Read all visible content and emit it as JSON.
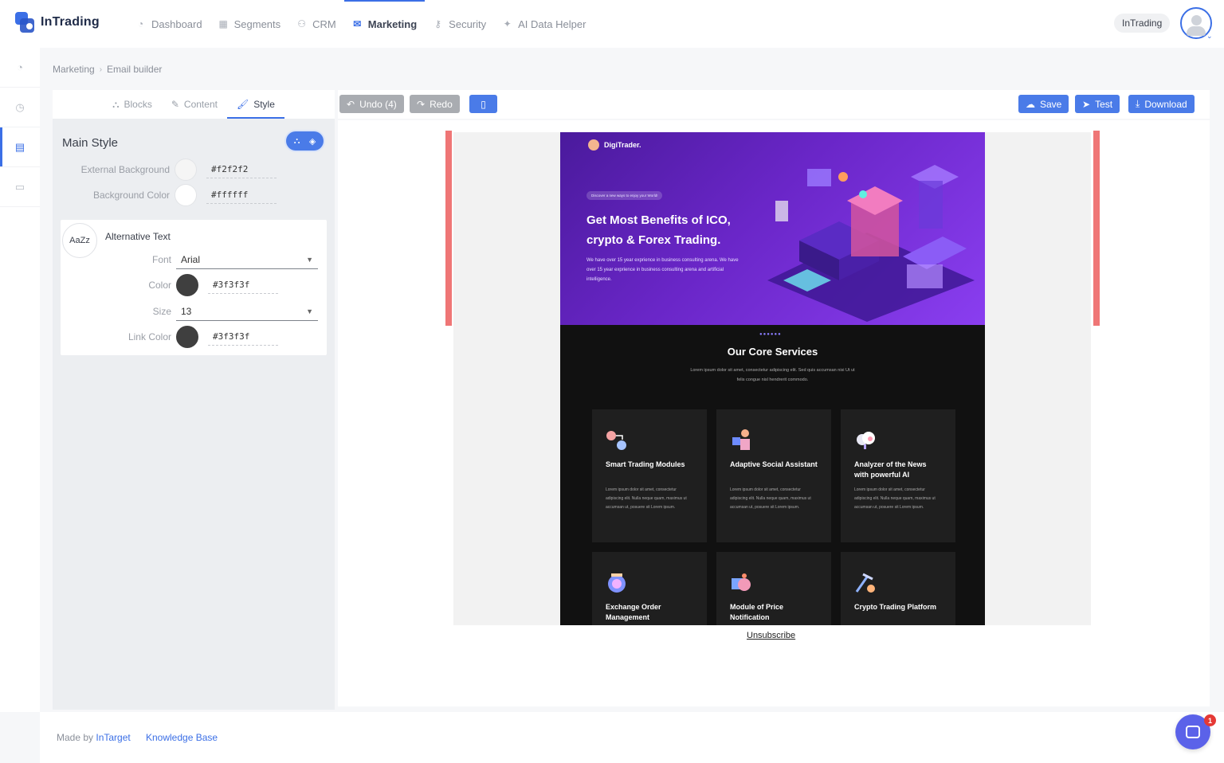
{
  "app": {
    "logo_text": "InTrading",
    "account_name": "InTrading"
  },
  "nav": {
    "items": [
      {
        "label": "Dashboard",
        "icon": "pie-chart-icon"
      },
      {
        "label": "Segments",
        "icon": "building-icon"
      },
      {
        "label": "CRM",
        "icon": "users-icon"
      },
      {
        "label": "Marketing",
        "icon": "envelope-icon",
        "active": true
      },
      {
        "label": "Security",
        "icon": "key-icon"
      },
      {
        "label": "AI Data Helper",
        "icon": "sparkle-icon"
      }
    ]
  },
  "rail": {
    "items": [
      {
        "icon": "pie-chart-icon"
      },
      {
        "icon": "clock-icon"
      },
      {
        "icon": "newspaper-icon",
        "active": true
      },
      {
        "icon": "chat-icon"
      }
    ]
  },
  "breadcrumb": {
    "items": [
      "Marketing",
      "Email builder"
    ]
  },
  "builder": {
    "tabs": [
      {
        "label": "Blocks",
        "icon": "cubes-icon"
      },
      {
        "label": "Content",
        "icon": "pencil-icon"
      },
      {
        "label": "Style",
        "icon": "brush-icon",
        "active": true
      }
    ],
    "main_style": {
      "title": "Main Style",
      "external_background_label": "External Background",
      "external_background_value": "#f2f2f2",
      "background_color_label": "Background Color",
      "background_color_value": "#ffffff"
    },
    "alt_text": {
      "badge": "AaZz",
      "title": "Alternative Text",
      "font_label": "Font",
      "font_value": "Arial",
      "color_label": "Color",
      "color_value": "#3f3f3f",
      "size_label": "Size",
      "size_value": "13",
      "link_color_label": "Link Color",
      "link_color_value": "#3f3f3f"
    }
  },
  "toolbar": {
    "undo_label": "Undo (4)",
    "redo_label": "Redo",
    "save_label": "Save",
    "test_label": "Test",
    "download_label": "Download"
  },
  "email": {
    "brand": "DigiTrader.",
    "pill": "Discover a new ways to enjoy your World!",
    "headline": "Get Most Benefits of ICO, crypto & Forex Trading.",
    "hero_body": "We have over 15 year exprience in business consulting arena. We have over 15 year exprience in business consulting arena and artificial intelligence.",
    "services_title": "Our Core Services",
    "services_sub": "Lorem ipsum dolor sit amet, consectetur adipiscing elit. Sed quis accumsan nisi Ut ut felis congue nisl hendrerit commodo.",
    "services": [
      {
        "title": "Smart Trading Modules",
        "body": "Lorem ipsum dolor sit amet, consectetur adipiscing elit. Nulla neque quam, maximus ut accumsan ut, posuere sit Lorem ipsum."
      },
      {
        "title": "Adaptive Social Assistant",
        "body": "Lorem ipsum dolor sit amet, consectetur adipiscing elit. Nulla neque quam, maximus ut accumsan ut, posuere sit Lorem ipsum."
      },
      {
        "title": "Analyzer of the News with powerful AI",
        "body": "Lorem ipsum dolor sit amet, consectetur adipiscing elit. Nulla neque quam, maximus ut accumsan ut, posuere sit Lorem ipsum."
      },
      {
        "title": "Exchange Order Management",
        "body": ""
      },
      {
        "title": "Module of Price Notification",
        "body": ""
      },
      {
        "title": "Crypto Trading Platform",
        "body": ""
      }
    ],
    "unsubscribe": "Unsubscribe"
  },
  "footer": {
    "made_by": "Made by",
    "made_by_link": "InTarget",
    "knowledge_base": "Knowledge Base"
  },
  "chat": {
    "badge_count": "1"
  },
  "colors": {
    "accent": "#3b6fe6",
    "button_blue": "#4a7be8",
    "button_grey": "#a9acb1",
    "hero_purple": "#6a26c8"
  }
}
